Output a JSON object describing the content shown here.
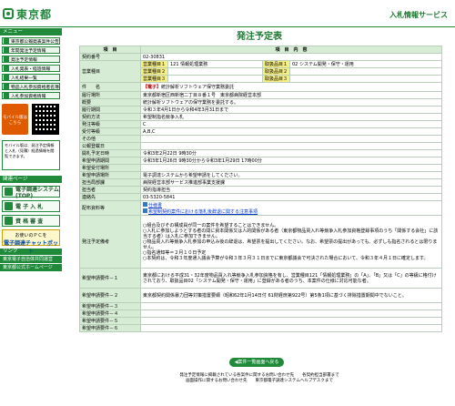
{
  "header": {
    "logo_text": "東京都",
    "service_title": "入札情報サービス"
  },
  "sidebar": {
    "menu_heading": "メニュー",
    "links": [
      "東京都公報発表案件公告",
      "年間発注予定情報",
      "発注予定情報",
      "入札発表・経過情報",
      "入札結果一覧",
      "物品入札参加資格者名簿",
      "入札参加資格情報"
    ],
    "mobile_badge": "モバイル版はこちら",
    "mobile_note": "モバイル版は、発注予定情報と入札（見積）経過情報を閲覧できます。",
    "related_heading": "関連ページ",
    "big_buttons": [
      "電子調達システム(TOP)",
      "電 子 入 札",
      "資 格 審 査"
    ],
    "check_button_line1": "お使いのＰＣを",
    "check_button_line2": "電子調達チャットボット",
    "links_heading": "リンク",
    "link_bars": [
      "東京電子自治体共同運営",
      "東京都公式ホームページ"
    ]
  },
  "main": {
    "page_title": "発注予定表",
    "col_item": "項　目",
    "col_content": "項　目　内　容",
    "rows": {
      "contract_no_label": "契約番号",
      "contract_no": "02-30831",
      "business_type_label": "営業種目",
      "business_type_1_label": "営業種目１",
      "business_type_1": "121 情報処理業務",
      "business_type_2_label": "営業種目２",
      "business_type_2": "",
      "business_type_3_label": "営業種目３",
      "business_type_3": "",
      "handled_item_1_label": "取扱品目１",
      "handled_item_1": "02 システム開発・保守・運用",
      "handled_item_2_label": "取扱品目２",
      "handled_item_2": "",
      "handled_item_3_label": "取扱品目３",
      "handled_item_3": "",
      "subject_label": "件　　名",
      "subject_tag": "【電子】",
      "subject": "統計解析ソフトウェア保守業務委託",
      "location_label": "履行場所",
      "location": "東京都新宿区西新宿二丁目８番１号　東京都病院経営本部",
      "overview_label": "概要",
      "overview": "統計解析ソフトウェアの保守業務を委託する。",
      "period_label": "履行期間",
      "period": "令和３年4月1日から令和4年3月31日まで",
      "contract_method_label": "契約方法",
      "contract_method": "希望制指名競争入札",
      "bid_type_label": "発注等級",
      "bid_type": "C",
      "acceptance_label": "受付等級",
      "acceptance": "A,B,C",
      "other_label": "その他",
      "other": "",
      "publish_date_label": "公報登載日",
      "publish_date": "",
      "open_date_label": "開札予定日時",
      "open_date": "令和3年2月22日 9時30分",
      "apply_period_label": "希望申請期間",
      "apply_period": "令和3年1月26日 9時30分から令和3年1月29日 17時00分",
      "apply_place_label": "希望受付場所",
      "apply_place": "",
      "apply_method_label": "希望申請場所",
      "apply_method": "電子調達システムから希望申請をしてください。",
      "dept_label": "担当局部課",
      "dept": "病院経営本部サービス推進部事業支援課",
      "person_label": "担当者",
      "person": "契約指導担当",
      "contact_label": "連絡先",
      "contact": "03-5320-5841",
      "attachment_label": "配布資料等",
      "attachment_1": "仕様書",
      "attachment_2": "希望制契約案件における落札後辞退に関する注意事項",
      "notes_label": "発注予定備考",
      "notes": "○組合及びその構成員が同一の案件を希望することはできません。\n○入札に参加しようとする者の間に資本関係又は人的関係がある者（東京都物品買入れ等競争入札参加資格登録事項のうち「関係する会社」に該当する者）は入札に参加できません。\n○物品買入れ等競争入札参加の申込み後の辞退は、希望票を提出してください。なお、希望票の提出があっても、必ずしも指名されるとは限りません。\n○指名通知等＝２月１０日予定\n○本契約は、令和３年度通入議会予算が令和３年３月３１日までに東京都議会で可決された場合において、令和３年４月１日に確定します。",
      "req1_label": "希望申請要件－１",
      "req1": "東京都における平成31・32年度物品買入れ等競争入札参加資格を有し、営業種目121「情報処理業務」の「A」、「B」又は「C」の等級に格付けされており、取扱品目02「システム開発・保守・運用」に登録がある者のうち、本案件の仕様に対応可能な者。",
      "req2_label": "希望申請要件－２",
      "req2": "東京都契約関係暴力団等対策措置要綱（昭和62年1月14日付 61財経庶第922号）第5条1項に基づく排除措置期間中でないこと。",
      "req3_label": "希望申請要件－３",
      "req3": "",
      "req4_label": "希望申請要件－４",
      "req4": "",
      "req5_label": "希望申請要件－５",
      "req5": "",
      "req6_label": "希望申請要件－６",
      "req6": ""
    },
    "back_button": "◀案件一覧画面へ戻る"
  },
  "footer": {
    "line1": "発注予定情報に掲載されている各案件に関するお問い合わせ先　　各契約担当部署まで",
    "line2": "画面操作に関するお問い合わせ先　　東京都電子調達システムヘルプデスクまで"
  }
}
